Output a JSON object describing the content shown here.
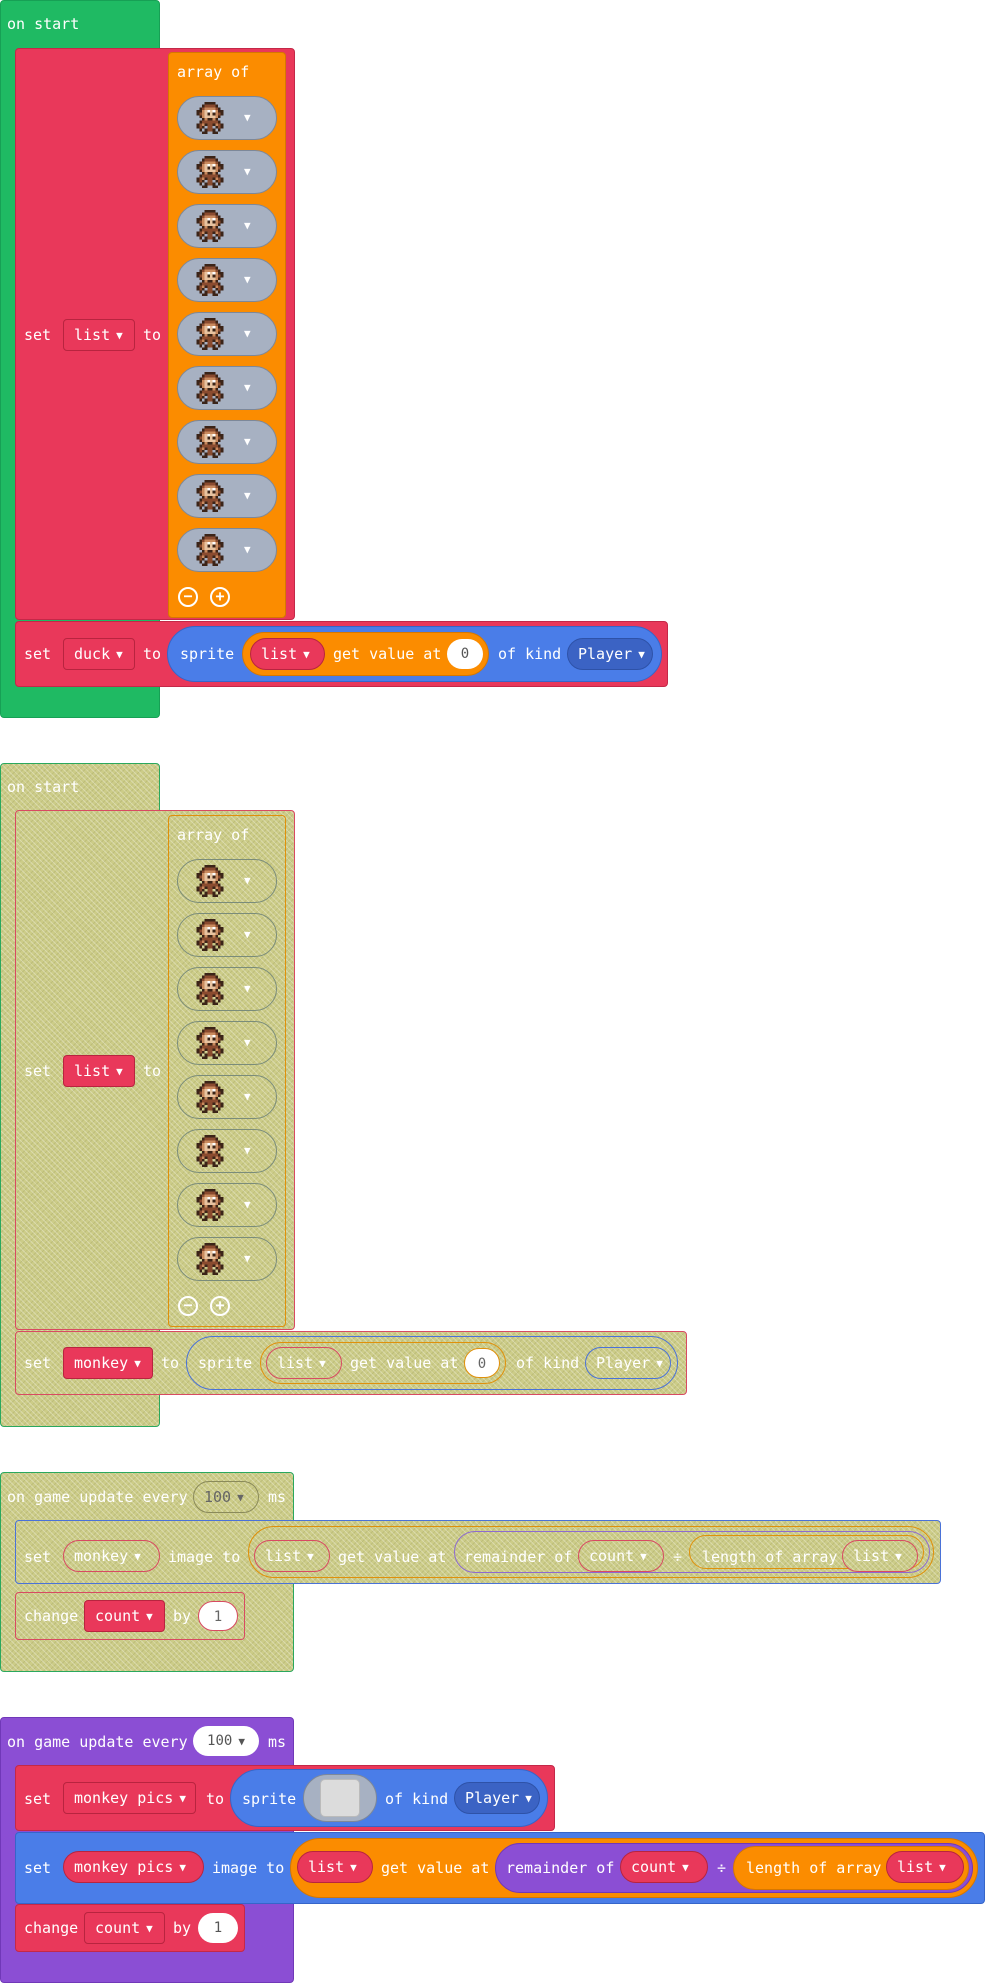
{
  "blocks": {
    "on_start_label": "on start",
    "set_label": "set",
    "to_label": "to",
    "array_of_label": "array of",
    "sprite_label": "sprite",
    "get_value_at_label": "get value at",
    "of_kind_label": "of kind",
    "image_to_label": "image to",
    "remainder_of_label": "remainder of",
    "divide_symbol": "÷",
    "length_of_array_label": "length of array",
    "change_label": "change",
    "by_label": "by",
    "on_game_update_label": "on game update every",
    "ms_label": "ms"
  },
  "stack1": {
    "list_var": "list",
    "duck_var": "duck",
    "index_value": "0",
    "kind_value": "Player",
    "image_count": 9
  },
  "stack2": {
    "list_var": "list",
    "monkey_var": "monkey",
    "index_value": "0",
    "kind_value": "Player",
    "image_count": 8
  },
  "stack3": {
    "interval_value": "100",
    "monkey_var": "monkey",
    "list_var": "list",
    "count_var": "count",
    "list_var2": "list",
    "change_var": "count",
    "change_by_value": "1"
  },
  "stack4": {
    "interval_value": "100",
    "monkey_pics_var": "monkey pics",
    "kind_value": "Player",
    "monkey_pics_var2": "monkey pics",
    "list_var": "list",
    "count_var": "count",
    "list_var2": "list",
    "change_var": "count",
    "change_by_value": "1"
  },
  "colors": {
    "event_green": "#1fba63",
    "variables_red": "#e9385a",
    "arrays_orange": "#fb8c00",
    "sprites_blue": "#4a7de8",
    "game_purple": "#8b4ed4",
    "disabled_hatch": "#cccc88"
  }
}
